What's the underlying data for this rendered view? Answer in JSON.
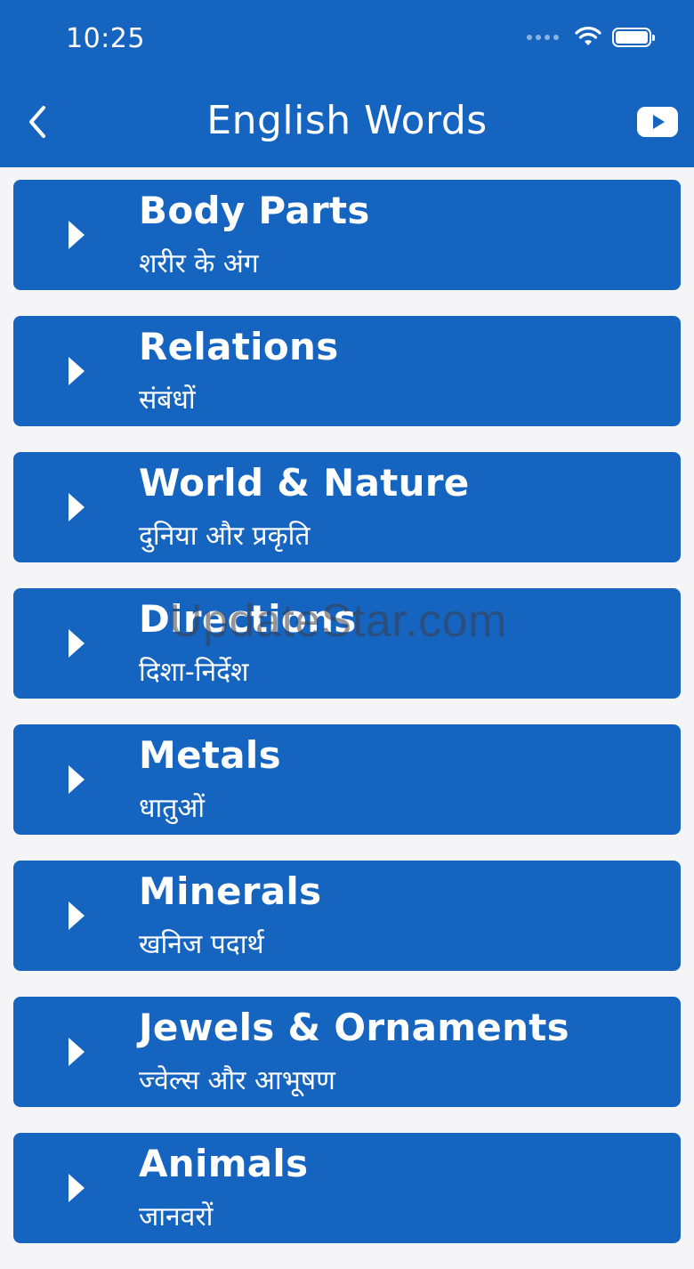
{
  "status_bar": {
    "time": "10:25"
  },
  "header": {
    "title": "English Words",
    "back_icon": "chevron-left-icon",
    "video_icon": "youtube-icon"
  },
  "categories": [
    {
      "title": "Body Parts",
      "subtitle": "शरीर के अंग"
    },
    {
      "title": "Relations",
      "subtitle": "संबंधों"
    },
    {
      "title": "World & Nature",
      "subtitle": "दुनिया और प्रकृति"
    },
    {
      "title": "Directions",
      "subtitle": "दिशा-निर्देश"
    },
    {
      "title": "Metals",
      "subtitle": "धातुओं"
    },
    {
      "title": "Minerals",
      "subtitle": "खनिज पदार्थ"
    },
    {
      "title": "Jewels & Ornaments",
      "subtitle": "ज्वेल्स और आभूषण"
    },
    {
      "title": "Animals",
      "subtitle": "जानवरों"
    }
  ],
  "watermark": "UpdateStar.com",
  "colors": {
    "primary": "#1565c0",
    "background": "#f5f5f7",
    "text_on_primary": "#ffffff"
  }
}
